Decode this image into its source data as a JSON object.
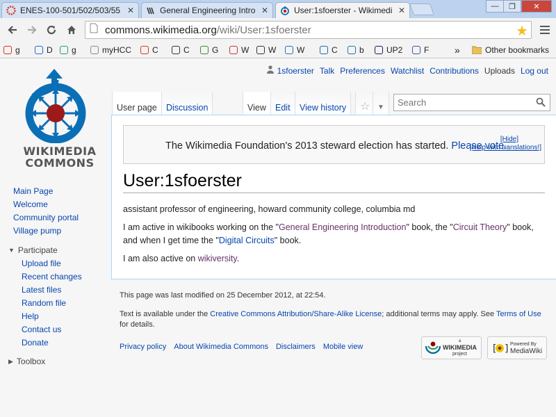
{
  "browser": {
    "tabs": [
      {
        "title": "ENES-100-501/502/503/55",
        "favicon": "hcc-gear-icon",
        "close": "✕"
      },
      {
        "title": "General Engineering Intro",
        "favicon": "wikibooks-icon",
        "close": "✕"
      },
      {
        "title": "User:1sfoerster - Wikimedi",
        "favicon": "commons-icon",
        "close": "✕"
      }
    ],
    "window_controls": {
      "minimize": "—",
      "maximize": "❐",
      "close": "✕"
    },
    "url_host": "commons.wikimedia.org",
    "url_path": "/wiki/User:1sfoerster",
    "bookmarks": [
      {
        "label": "g",
        "icon": "gmail-icon",
        "color": "#d93025"
      },
      {
        "label": "D",
        "icon": "dropbox-icon",
        "color": "#1e6ecf"
      },
      {
        "label": "g",
        "icon": "google-drive-icon",
        "color": "#1da462"
      },
      {
        "label": "myHCC",
        "icon": "page-icon",
        "color": "#888888"
      },
      {
        "label": "C",
        "icon": "hcc-gear-icon",
        "color": "#d9361e"
      },
      {
        "label": "C",
        "icon": "canvas-icon",
        "color": "#333333"
      },
      {
        "label": "G",
        "icon": "gnome-icon",
        "color": "#3b8a2e"
      },
      {
        "label": "W",
        "icon": "wikiversity-icon",
        "color": "#c0392b"
      },
      {
        "label": "W",
        "icon": "wikibooks-icon",
        "color": "#333333"
      },
      {
        "label": "W",
        "icon": "wikimedia-icon",
        "color": "#2a6eb8"
      },
      {
        "label": "C",
        "icon": "commons-icon",
        "color": "#0b6fb6"
      },
      {
        "label": "b",
        "icon": "wordpress-icon",
        "color": "#21759b"
      },
      {
        "label": "UP2",
        "icon": "up2-icon",
        "color": "#1a1a5a"
      },
      {
        "label": "F",
        "icon": "facebook-icon",
        "color": "#3b5998"
      }
    ],
    "bookmarks_overflow": "»",
    "other_bookmarks": "Other bookmarks"
  },
  "logo": {
    "line1": "WIKIMEDIA",
    "line2": "COMMONS"
  },
  "sidebar": {
    "main": [
      "Main Page",
      "Welcome",
      "Community portal",
      "Village pump"
    ],
    "participate_heading": "Participate",
    "participate": [
      "Upload file",
      "Recent changes",
      "Latest files",
      "Random file",
      "Help",
      "Contact us",
      "Donate"
    ],
    "toolbox_heading": "Toolbox"
  },
  "personal": {
    "username": "1sfoerster",
    "links": [
      "Talk",
      "Preferences",
      "Watchlist",
      "Contributions",
      "Uploads",
      "Log out"
    ]
  },
  "tabs": {
    "user_page": "User page",
    "discussion": "Discussion",
    "view": "View",
    "edit": "Edit",
    "view_history": "View history"
  },
  "search": {
    "placeholder": "Search"
  },
  "sitenotice": {
    "message": "The Wikimedia Foundation's 2013 steward election has started.",
    "link": "Please vote.",
    "hide": "[Hide]",
    "help": "[Help with translations!]"
  },
  "page": {
    "title": "User:1sfoerster",
    "intro": "assistant professor of engineering, howard community college, columbia md",
    "p2_a": "I am active in wikibooks working on the \"",
    "p2_link1": "General Engineering Introduction",
    "p2_b": "\" book, the \"",
    "p2_link2": "Circuit Theory",
    "p2_c": "\" book, and when I get time the \"",
    "p2_link3": "Digital Circuits",
    "p2_d": "\" book.",
    "p3_a": "I am also active on ",
    "p3_link": "wikiversity",
    "p3_b": "."
  },
  "footer": {
    "last_modified": "This page was last modified on 25 December 2012, at 22:54.",
    "license_a": "Text is available under the ",
    "license_link": "Creative Commons Attribution/Share-Alike License",
    "license_b": "; additional terms may apply. See ",
    "terms_link": "Terms of Use",
    "license_c": " for details.",
    "places": [
      "Privacy policy",
      "About Wikimedia Commons",
      "Disclaimers",
      "Mobile view"
    ],
    "badge1_small": "a",
    "badge1_main": "WIKIMEDIA",
    "badge1_sub": "project",
    "badge2_small": "Powered By",
    "badge2_main": "MediaWiki"
  }
}
